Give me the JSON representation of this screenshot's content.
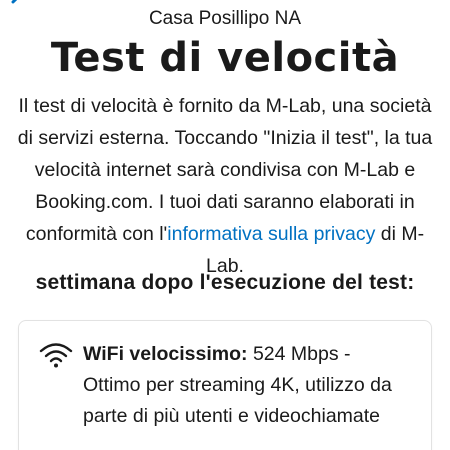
{
  "nav": {
    "title": "Casa Posillipo NA",
    "back_icon": "chevron-left-icon",
    "accent": "#0071c2"
  },
  "heading": "Test di velocità",
  "description": {
    "before_link": "Il test di velocità è fornito da M-Lab, una società di servizi esterna. Toccando \"Inizia il test\", la tua velocità internet sarà condivisa con M-Lab e Booking.com. I tuoi dati saranno elaborati in conformità con l'",
    "link": "informativa sulla privacy",
    "after_link": " di M-Lab."
  },
  "week_line": "settimana dopo l'esecuzione del test:",
  "result_card": {
    "icon": "wifi-icon",
    "title": "WiFi velocissimo:",
    "speed": " 524 Mbps -",
    "detail": "Ottimo per streaming 4K, utilizzo da parte di più utenti e videochiamate"
  }
}
